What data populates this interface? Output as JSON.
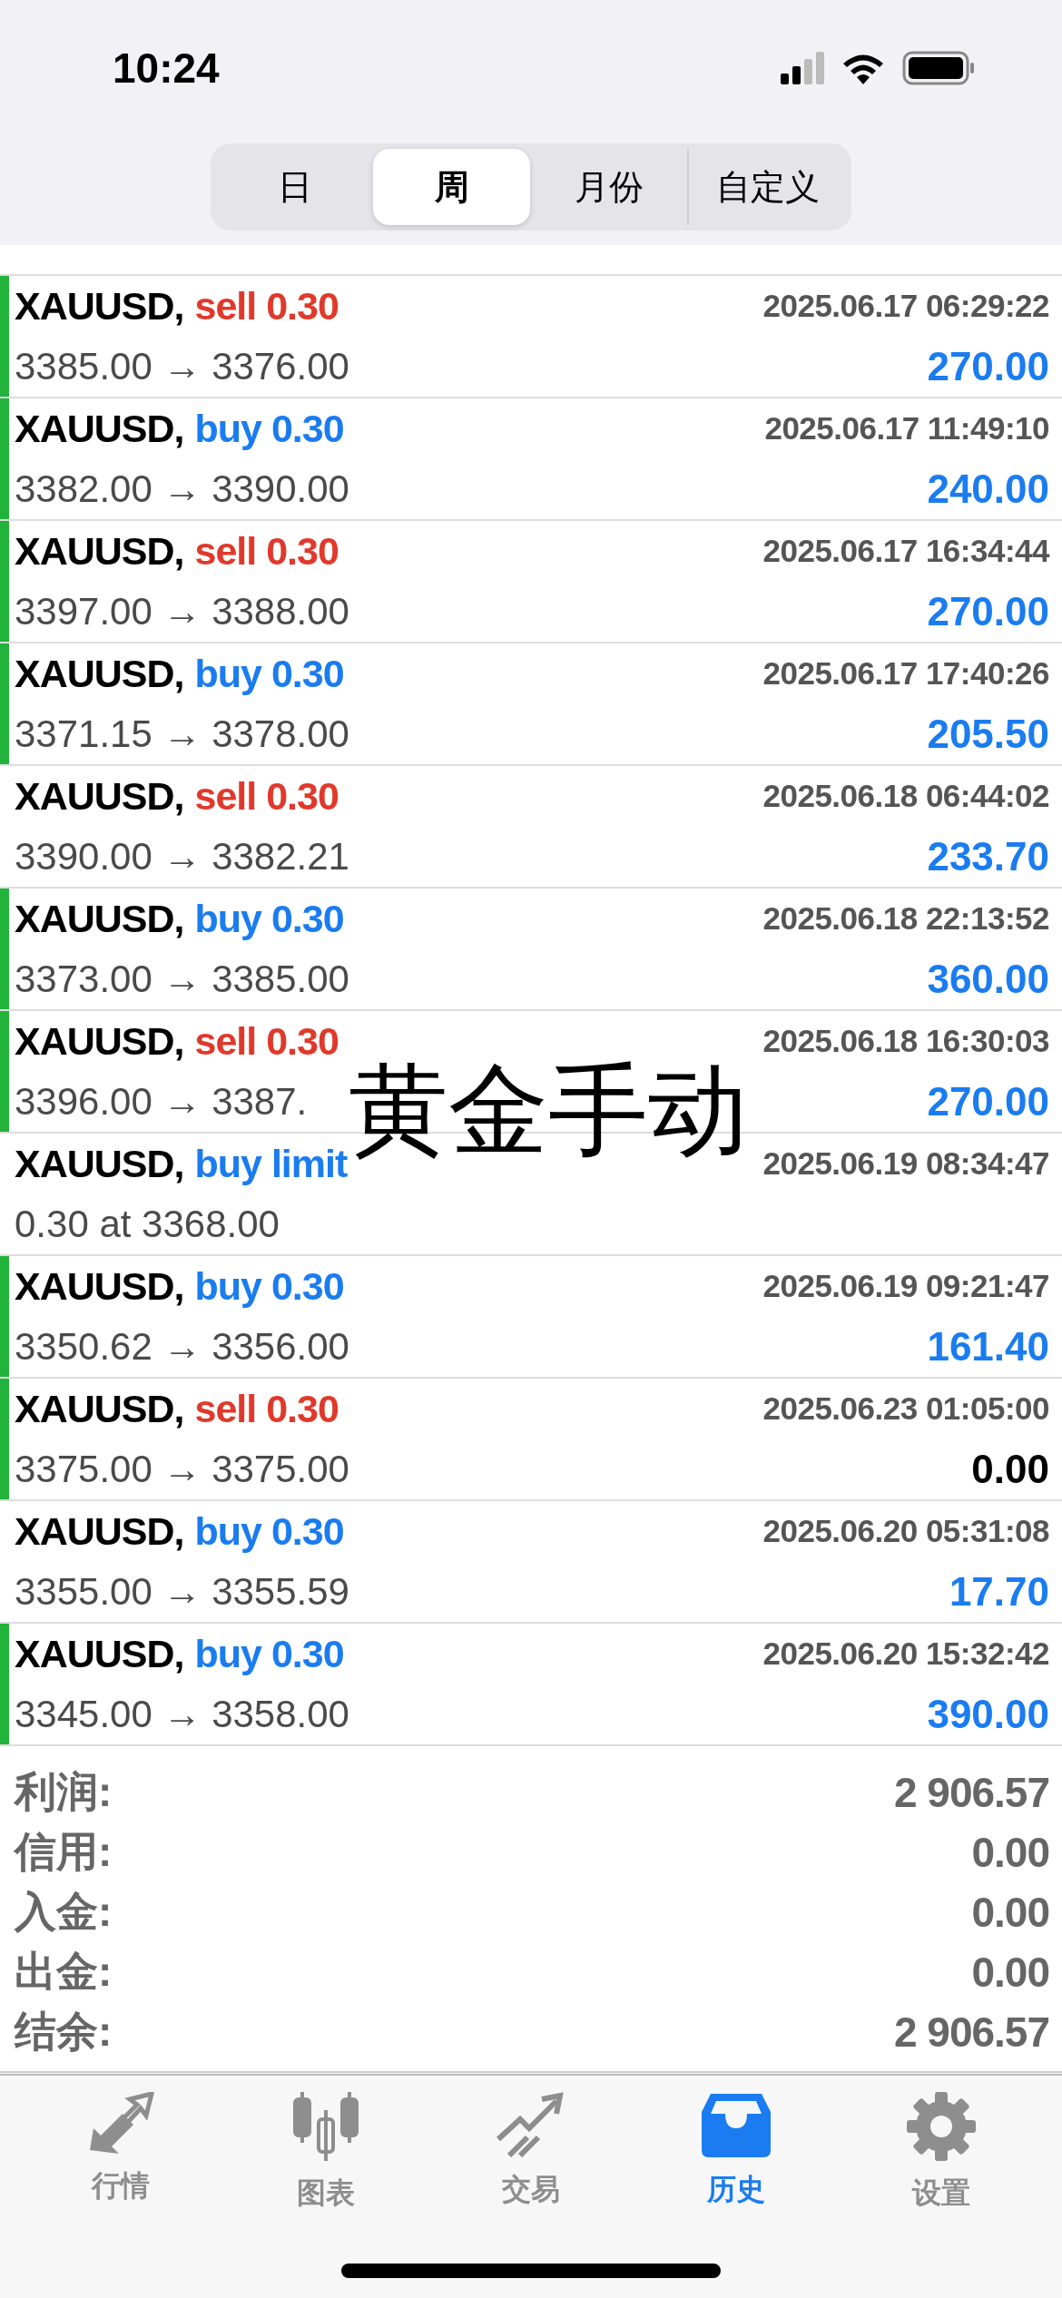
{
  "status_bar": {
    "time": "10:24"
  },
  "period_tabs": [
    {
      "label": "日",
      "selected": false
    },
    {
      "label": "周",
      "selected": true
    },
    {
      "label": "月份",
      "selected": false
    },
    {
      "label": "自定义",
      "selected": false
    }
  ],
  "deals": [
    {
      "symbol": "XAUUSD,",
      "order": {
        "text": "sell 0.30",
        "color": "#e0392b"
      },
      "time": "2025.06.17 06:29:22",
      "prices": "3385.00 → 3376.00",
      "profit": {
        "text": "270.00",
        "color": "#1a7cf0"
      },
      "marked": true
    },
    {
      "symbol": "XAUUSD,",
      "order": {
        "text": "buy 0.30",
        "color": "#1a7cf0"
      },
      "time": "2025.06.17 11:49:10",
      "prices": "3382.00 → 3390.00",
      "profit": {
        "text": "240.00",
        "color": "#1a7cf0"
      },
      "marked": true
    },
    {
      "symbol": "XAUUSD,",
      "order": {
        "text": "sell 0.30",
        "color": "#e0392b"
      },
      "time": "2025.06.17 16:34:44",
      "prices": "3397.00 → 3388.00",
      "profit": {
        "text": "270.00",
        "color": "#1a7cf0"
      },
      "marked": true
    },
    {
      "symbol": "XAUUSD,",
      "order": {
        "text": "buy 0.30",
        "color": "#1a7cf0"
      },
      "time": "2025.06.17 17:40:26",
      "prices": "3371.15 → 3378.00",
      "profit": {
        "text": "205.50",
        "color": "#1a7cf0"
      },
      "marked": true
    },
    {
      "symbol": "XAUUSD,",
      "order": {
        "text": "sell 0.30",
        "color": "#e0392b"
      },
      "time": "2025.06.18 06:44:02",
      "prices": "3390.00 → 3382.21",
      "profit": {
        "text": "233.70",
        "color": "#1a7cf0"
      },
      "marked": false
    },
    {
      "symbol": "XAUUSD,",
      "order": {
        "text": "buy 0.30",
        "color": "#1a7cf0"
      },
      "time": "2025.06.18 22:13:52",
      "prices": "3373.00 → 3385.00",
      "profit": {
        "text": "360.00",
        "color": "#1a7cf0"
      },
      "marked": true
    },
    {
      "symbol": "XAUUSD,",
      "order": {
        "text": "sell 0.30",
        "color": "#e0392b"
      },
      "time": "2025.06.18 16:30:03",
      "prices": "3396.00 → 3387.",
      "profit": {
        "text": "270.00",
        "color": "#1a7cf0"
      },
      "marked": true
    },
    {
      "symbol": "XAUUSD,",
      "order": {
        "text": "buy limit",
        "color": "#1a7cf0"
      },
      "time": "2025.06.19 08:34:47",
      "prices": "0.30 at 3368.00",
      "marked": false
    },
    {
      "symbol": "XAUUSD,",
      "order": {
        "text": "buy 0.30",
        "color": "#1a7cf0"
      },
      "time": "2025.06.19 09:21:47",
      "prices": "3350.62 → 3356.00",
      "profit": {
        "text": "161.40",
        "color": "#1a7cf0"
      },
      "marked": true
    },
    {
      "symbol": "XAUUSD,",
      "order": {
        "text": "sell 0.30",
        "color": "#e0392b"
      },
      "time": "2025.06.23 01:05:00",
      "prices": "3375.00 → 3375.00",
      "profit": {
        "text": "0.00",
        "color": "#000000"
      },
      "marked": true
    },
    {
      "symbol": "XAUUSD,",
      "order": {
        "text": "buy 0.30",
        "color": "#1a7cf0"
      },
      "time": "2025.06.20 05:31:08",
      "prices": "3355.00 → 3355.59",
      "profit": {
        "text": "17.70",
        "color": "#1a7cf0"
      },
      "marked": false
    },
    {
      "symbol": "XAUUSD,",
      "order": {
        "text": "buy 0.30",
        "color": "#1a7cf0"
      },
      "time": "2025.06.20 15:32:42",
      "prices": "3345.00 → 3358.00",
      "profit": {
        "text": "390.00",
        "color": "#1a7cf0"
      },
      "marked": true
    }
  ],
  "overlay_caption": "黄金手动",
  "summary": [
    {
      "label": "利润:",
      "value": "2 906.57"
    },
    {
      "label": "信用:",
      "value": "0.00"
    },
    {
      "label": "入金:",
      "value": "0.00"
    },
    {
      "label": "出金:",
      "value": "0.00"
    },
    {
      "label": "结余:",
      "value": "2 906.57"
    }
  ],
  "tab_bar": [
    {
      "kind": "quotes",
      "label": "行情",
      "selected": false
    },
    {
      "kind": "chart",
      "label": "图表",
      "selected": false
    },
    {
      "kind": "trade",
      "label": "交易",
      "selected": false
    },
    {
      "kind": "history",
      "label": "历史",
      "selected": true
    },
    {
      "kind": "settings",
      "label": "设置",
      "selected": false
    }
  ]
}
